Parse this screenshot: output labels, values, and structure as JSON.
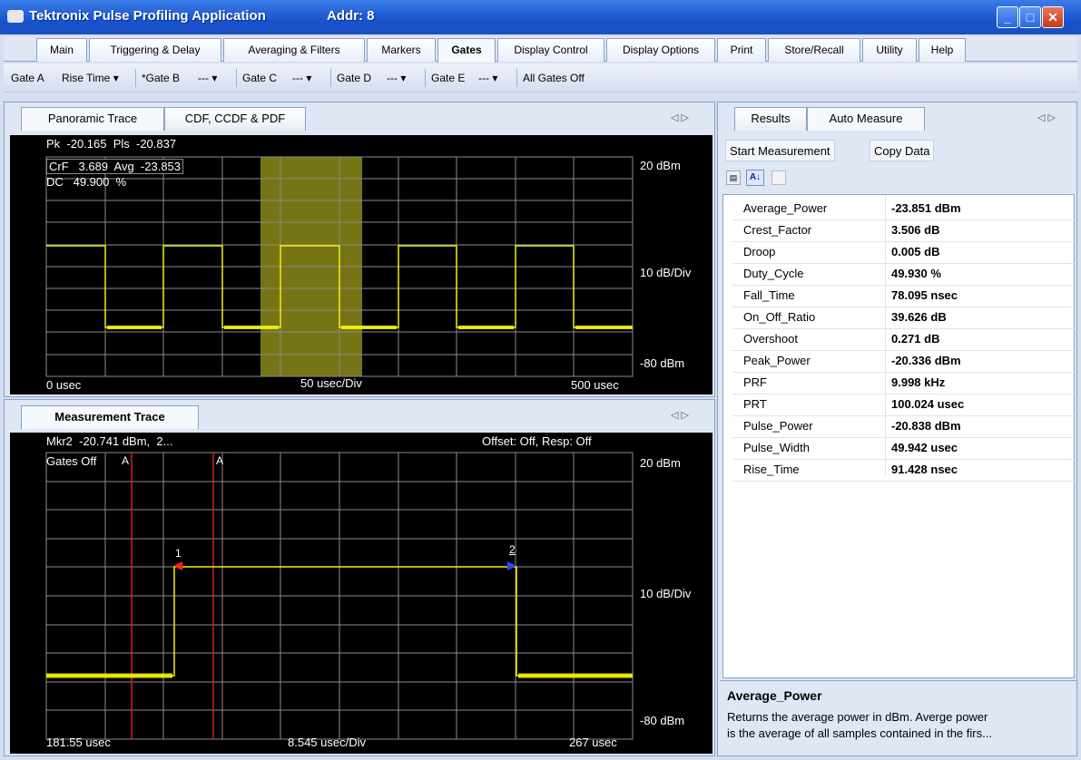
{
  "window": {
    "title": "Tektronix Pulse Profiling Application",
    "addr": "Addr: 8"
  },
  "menu_tabs": [
    "Main",
    "Triggering & Delay",
    "Averaging & Filters",
    "Markers",
    "Gates",
    "Display Control",
    "Display Options",
    "Print",
    "Store/Recall",
    "Utility",
    "Help"
  ],
  "active_menu_tab": "Gates",
  "gate_bar": {
    "gate_a": "Gate A",
    "gate_a_value": "Rise Time",
    "gate_b": "*Gate B",
    "gate_b_value": "---",
    "gate_c": "Gate C",
    "gate_c_value": "---",
    "gate_d": "Gate D",
    "gate_d_value": "---",
    "gate_e": "Gate E",
    "gate_e_value": "---",
    "all_off": "All Gates Off"
  },
  "top_panel": {
    "tabs": [
      "Panoramic Trace",
      "CDF, CCDF & PDF"
    ],
    "readout_line1": "Pk  -20.165  Pls  -20.837",
    "readout_crf": "CrF   3.689  Avg  -23.853",
    "readout_dc": "DC   49.900  %",
    "top_level": "20 dBm",
    "scale": "10 dB/Div",
    "bottom_level": "-80 dBm",
    "x_start": "0 usec",
    "x_div": "50 usec/Div",
    "x_end": "500 usec"
  },
  "bottom_panel": {
    "tab": "Measurement Trace",
    "marker_readout": "Mkr2  -20.741 dBm,  2...",
    "offset_readout": "Offset: Off, Resp: Off",
    "gates_label": "Gates Off",
    "gate_marker_label": "A",
    "marker1_label": "1",
    "marker2_label": "2",
    "top_level": "20 dBm",
    "scale": "10 dB/Div",
    "bottom_level": "-80 dBm",
    "x_start": "181.55 usec",
    "x_div": "8.545 usec/Div",
    "x_end": "267 usec"
  },
  "right_panel": {
    "tabs": [
      "Results",
      "Auto Measure"
    ],
    "start_button": "Start Measurement",
    "copy_button": "Copy Data",
    "rows": [
      {
        "name": "Average_Power",
        "value": "-23.851 dBm"
      },
      {
        "name": "Crest_Factor",
        "value": "3.506 dB"
      },
      {
        "name": "Droop",
        "value": "0.005 dB"
      },
      {
        "name": "Duty_Cycle",
        "value": "49.930 %"
      },
      {
        "name": "Fall_Time",
        "value": "78.095 nsec"
      },
      {
        "name": "On_Off_Ratio",
        "value": "39.626 dB"
      },
      {
        "name": "Overshoot",
        "value": "0.271 dB"
      },
      {
        "name": "Peak_Power",
        "value": "-20.336 dBm"
      },
      {
        "name": "PRF",
        "value": "9.998 kHz"
      },
      {
        "name": "PRT",
        "value": "100.024 usec"
      },
      {
        "name": "Pulse_Power",
        "value": "-20.838 dBm"
      },
      {
        "name": "Pulse_Width",
        "value": "49.942 usec"
      },
      {
        "name": "Rise_Time",
        "value": "91.428 nsec"
      }
    ],
    "desc_title": "Average_Power",
    "desc_line1": "Returns the average power in dBm. Averge power",
    "desc_line2": "is the average of all samples contained in the firs..."
  },
  "colors": {
    "trace": "#f2f20a",
    "gate_band": "#8a8a1a",
    "gate_line": "#d02020",
    "marker1": "#ff2020",
    "marker2": "#2050ff",
    "grid": "#8c8c8c"
  }
}
